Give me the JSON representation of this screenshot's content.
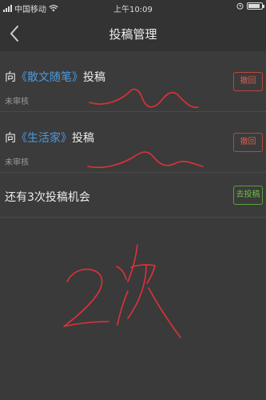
{
  "status_bar": {
    "carrier": "中国移动",
    "time": "上午10:09"
  },
  "nav": {
    "title": "投稿管理"
  },
  "submissions": [
    {
      "prefix": "向",
      "magazine": "《散文随笔》",
      "suffix": "投稿",
      "status": "未审核",
      "action": "撤回"
    },
    {
      "prefix": "向",
      "magazine": "《生活家》",
      "suffix": "投稿",
      "status": "未审核",
      "action": "撤回"
    }
  ],
  "chance": {
    "text": "还有3次投稿机会",
    "action": "去投稿"
  },
  "annotation": {
    "text": "2次",
    "color": "#e0313a"
  },
  "colors": {
    "magazine_link": "#4a9be0",
    "withdraw": "#d5604b",
    "go": "#6cbf45"
  }
}
